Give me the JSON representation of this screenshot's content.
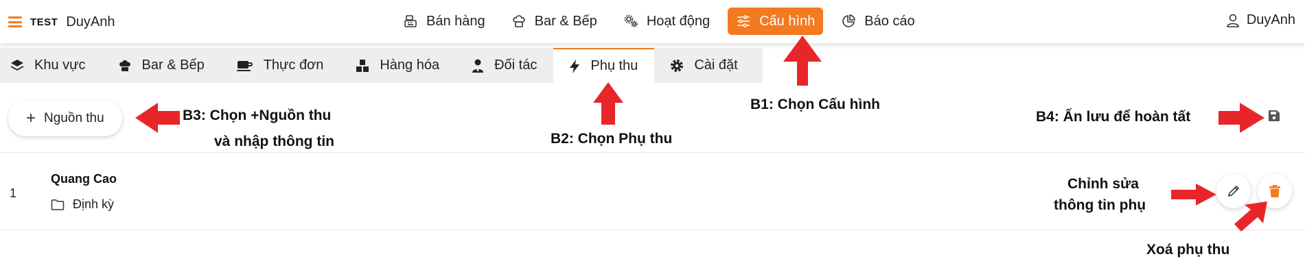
{
  "brand": {
    "test_label": "TEST",
    "name": "DuyAnh"
  },
  "nav": {
    "items": [
      {
        "label": "Bán hàng",
        "icon": "cash-register-icon"
      },
      {
        "label": "Bar & Bếp",
        "icon": "chef-icon"
      },
      {
        "label": "Hoạt động",
        "icon": "gears-icon"
      },
      {
        "label": "Cấu hình",
        "icon": "sliders-icon",
        "active": true
      },
      {
        "label": "Báo cáo",
        "icon": "pie-chart-icon"
      }
    ],
    "user": "DuyAnh"
  },
  "tabs": [
    {
      "label": "Khu vực",
      "icon": "layers-icon"
    },
    {
      "label": "Bar & Bếp",
      "icon": "chef-icon"
    },
    {
      "label": "Thực đơn",
      "icon": "coffee-icon"
    },
    {
      "label": "Hàng hóa",
      "icon": "boxes-icon"
    },
    {
      "label": "Đối tác",
      "icon": "person-tie-icon"
    },
    {
      "label": "Phụ thu",
      "icon": "bolt-icon",
      "active": true
    },
    {
      "label": "Cài đặt",
      "icon": "gear-icon"
    }
  ],
  "toolbar": {
    "add_label": "Nguồn thu",
    "save_icon": "floppy-disk-icon"
  },
  "rows": [
    {
      "index": "1",
      "name": "Quang Cao",
      "type": "Định kỳ"
    }
  ],
  "annotations": {
    "b1": "B1: Chọn Cấu hình",
    "b2": "B2: Chọn Phụ thu",
    "b3_line1": "B3: Chọn +Nguồn thu",
    "b3_line2": "và nhập thông tin",
    "b4": "B4: Ấn lưu để hoàn tất",
    "edit_line1": "Chỉnh sửa",
    "edit_line2": "thông tin phụ",
    "delete": "Xoá phụ thu"
  },
  "colors": {
    "accent": "#f37a20",
    "arrow": "#e8262a",
    "tab_bg": "#eeeeee"
  }
}
